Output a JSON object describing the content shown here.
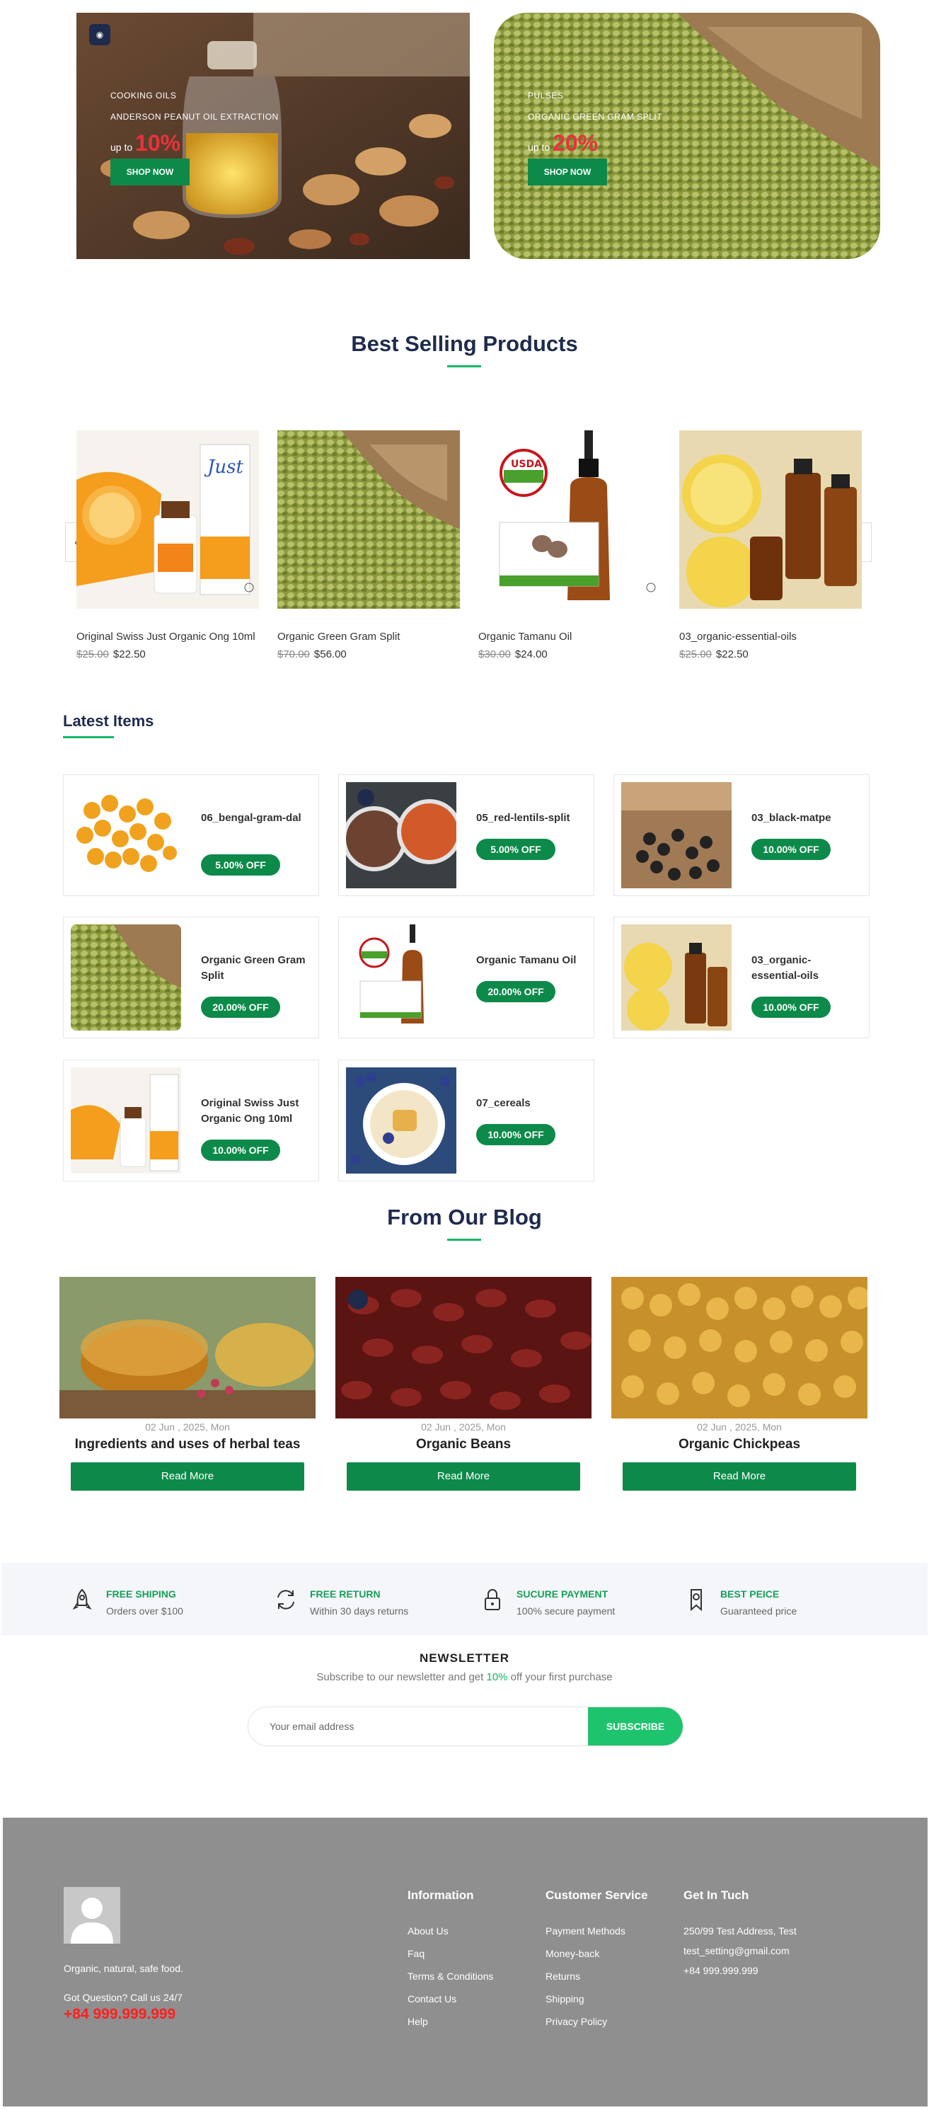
{
  "banners": [
    {
      "category": "COOKING OILS",
      "title": "ANDERSON PEANUT OIL EXTRACTION",
      "prefix": "up to",
      "percent": "10%",
      "button": "SHOP NOW"
    },
    {
      "category": "PULSES",
      "title": "ORGANIC GREEN GRAM SPLIT",
      "prefix": "up to",
      "percent": "20%",
      "button": "SHOP NOW"
    }
  ],
  "best_selling": {
    "title": "Best Selling Products",
    "products": [
      {
        "name": "Original Swiss Just Organic Ong 10ml",
        "old_price": "$25.00",
        "price": "$22.50"
      },
      {
        "name": "Organic Green Gram Split",
        "old_price": "$70.00",
        "price": "$56.00"
      },
      {
        "name": "Organic Tamanu Oil",
        "old_price": "$30.00",
        "price": "$24.00"
      },
      {
        "name": "03_organic-essential-oils",
        "old_price": "$25.00",
        "price": "$22.50"
      }
    ],
    "prev_arrow": "‹",
    "next_arrow": "›"
  },
  "latest": {
    "title": "Latest Items",
    "items": [
      {
        "name": "06_bengal-gram-dal",
        "discount": "5.00% OFF"
      },
      {
        "name": "05_red-lentils-split",
        "discount": "5.00% OFF"
      },
      {
        "name": "03_black-matpe",
        "discount": "10.00% OFF"
      },
      {
        "name": "Organic Green Gram Split",
        "discount": "20.00% OFF"
      },
      {
        "name": "Organic Tamanu Oil",
        "discount": "20.00% OFF"
      },
      {
        "name": "03_organic-essential-oils",
        "discount": "10.00% OFF"
      },
      {
        "name": "Original Swiss Just Organic Ong 10ml",
        "discount": "10.00% OFF"
      },
      {
        "name": "07_cereals",
        "discount": "10.00% OFF"
      }
    ]
  },
  "blog": {
    "title": "From Our Blog",
    "posts": [
      {
        "date": "02 Jun , 2025, Mon",
        "title": "Ingredients and uses of herbal teas",
        "button": "Read More"
      },
      {
        "date": "02 Jun , 2025, Mon",
        "title": "Organic Beans",
        "button": "Read More"
      },
      {
        "date": "02 Jun , 2025, Mon",
        "title": "Organic Chickpeas",
        "button": "Read More"
      }
    ]
  },
  "features": [
    {
      "icon": "rocket-icon",
      "title": "FREE SHIPING",
      "subtitle": "Orders over $100"
    },
    {
      "icon": "refresh-icon",
      "title": "FREE RETURN",
      "subtitle": "Within 30 days returns"
    },
    {
      "icon": "lock-icon",
      "title": "SUCURE PAYMENT",
      "subtitle": "100% secure payment"
    },
    {
      "icon": "badge-icon",
      "title": "BEST PEICE",
      "subtitle": "Guaranteed price"
    }
  ],
  "newsletter": {
    "title": "NEWSLETTER",
    "sub_before": "Subscribe to our newsletter and get ",
    "sub_highlight": "10%",
    "sub_after": " off your first purchase",
    "placeholder": "Your email address",
    "button": "SUBSCRIBE"
  },
  "footer": {
    "tagline": "Organic, natural, safe food.",
    "question": "Got Question? Call us 24/7",
    "phone": "+84 999.999.999",
    "information": {
      "title": "Information",
      "links": [
        "About Us",
        "Faq",
        "Terms & Conditions",
        "Contact Us",
        "Help"
      ]
    },
    "customer_service": {
      "title": "Customer Service",
      "links": [
        "Payment Methods",
        "Money-back",
        "Returns",
        "Shipping",
        "Privacy Policy"
      ]
    },
    "get_in_touch": {
      "title": "Get In Tuch",
      "lines": [
        "250/99 Test Address, Test",
        "test_setting@gmail.com",
        "+84 999.999.999"
      ]
    }
  },
  "colors": {
    "primary_green": "#0d8a4a",
    "accent_green": "#16b66a",
    "heading_navy": "#1f2b4d",
    "sale_red": "#e8323c",
    "footer_bg": "#8f8f8f"
  }
}
